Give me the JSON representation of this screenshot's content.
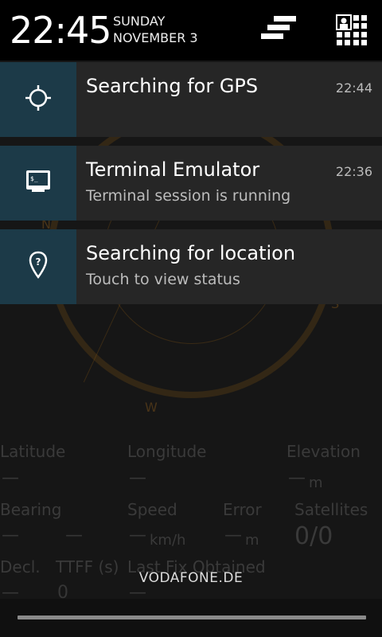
{
  "status_bar": {
    "time": "22:45",
    "day": "SUNDAY",
    "date": "NOVEMBER 3",
    "settings_icon": "quick-settings-icon",
    "clear_icon": "clear-all-icon"
  },
  "notifications": [
    {
      "icon": "gps-crosshair-icon",
      "title": "Searching for GPS",
      "text": "",
      "time": "22:44"
    },
    {
      "icon": "terminal-icon",
      "title": "Terminal Emulator",
      "text": "Terminal session is running",
      "time": "22:36"
    },
    {
      "icon": "location-question-icon",
      "title": "Searching for location",
      "text": "Touch to view status",
      "time": ""
    }
  ],
  "carrier": "VODAFONE.DE",
  "background_app": {
    "compass_letters": [
      "N",
      "S",
      "W"
    ],
    "fields": {
      "latitude": {
        "label": "Latitude",
        "value": "—"
      },
      "longitude": {
        "label": "Longitude",
        "value": "—"
      },
      "elevation": {
        "label": "Elevation",
        "value": "—",
        "unit": "m"
      },
      "bearing": {
        "label": "Bearing",
        "value": "—"
      },
      "speed": {
        "label": "Speed",
        "value": "—",
        "unit": "km/h"
      },
      "error": {
        "label": "Error",
        "value": "—",
        "unit": "m"
      },
      "satellites": {
        "label": "Satellites",
        "value": "0/0"
      },
      "decl": {
        "label": "Decl.",
        "value": "—"
      },
      "ttff": {
        "label": "TTFF (s)",
        "value": "0"
      },
      "last_fix": {
        "label": "Last Fix Obtained",
        "value": "—"
      }
    }
  },
  "colors": {
    "icon_tile": "#1c3a48",
    "notification_bg": "#262626",
    "status_bar_bg": "#000000"
  }
}
